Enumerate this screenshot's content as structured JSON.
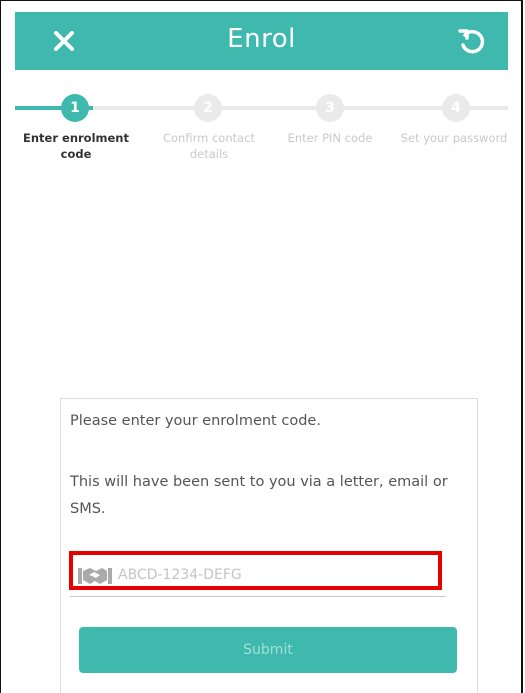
{
  "header": {
    "title": "Enrol",
    "close_icon": "close-icon",
    "reset_icon": "undo-icon"
  },
  "stepper": {
    "steps": [
      {
        "number": "1",
        "label": "Enter enrolment code",
        "state": "active"
      },
      {
        "number": "2",
        "label": "Confirm contact details",
        "state": "inactive"
      },
      {
        "number": "3",
        "label": "Enter PIN code",
        "state": "inactive"
      },
      {
        "number": "4",
        "label": "Set your password",
        "state": "inactive"
      }
    ]
  },
  "form": {
    "instruction": "Please enter your enrolment code.",
    "note": "This will have been sent to you via a letter, email or SMS.",
    "code_placeholder": "ABCD-1234-DEFG",
    "code_value": "",
    "submit_label": "Submit"
  },
  "colors": {
    "accent": "#3fb8ad",
    "highlight": "#e60000"
  }
}
